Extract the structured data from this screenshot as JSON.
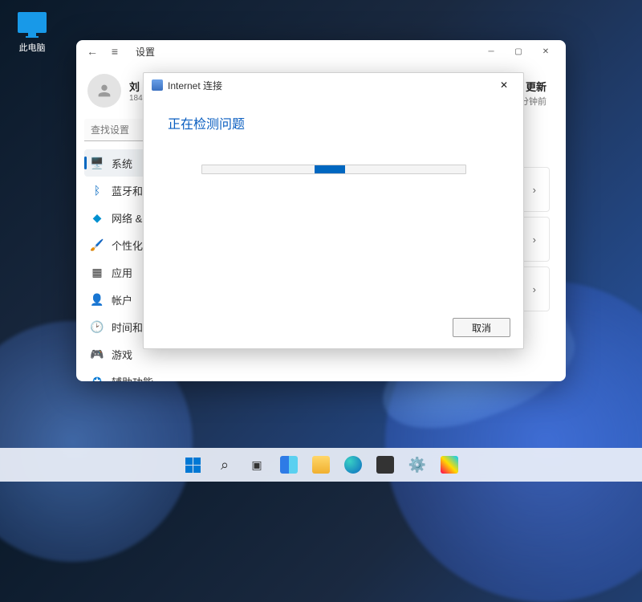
{
  "desktop": {
    "this_pc": "此电脑"
  },
  "settings": {
    "title": "设置",
    "profile": {
      "name": "刘",
      "sub": "184"
    },
    "search_placeholder": "查找设置",
    "nav": {
      "system": "系统",
      "bluetooth": "蓝牙和其",
      "network": "网络 & In",
      "personalize": "个性化",
      "apps": "应用",
      "accounts": "帐户",
      "time": "时间和语",
      "gaming": "游戏",
      "accessibility": "辅助功能"
    },
    "main": {
      "update_title": "s 更新",
      "update_sub": "时间: 17 分钟前"
    }
  },
  "dialog": {
    "title": "Internet 连接",
    "heading": "正在检测问题",
    "cancel": "取消"
  },
  "colors": {
    "accent": "#0067c0"
  }
}
